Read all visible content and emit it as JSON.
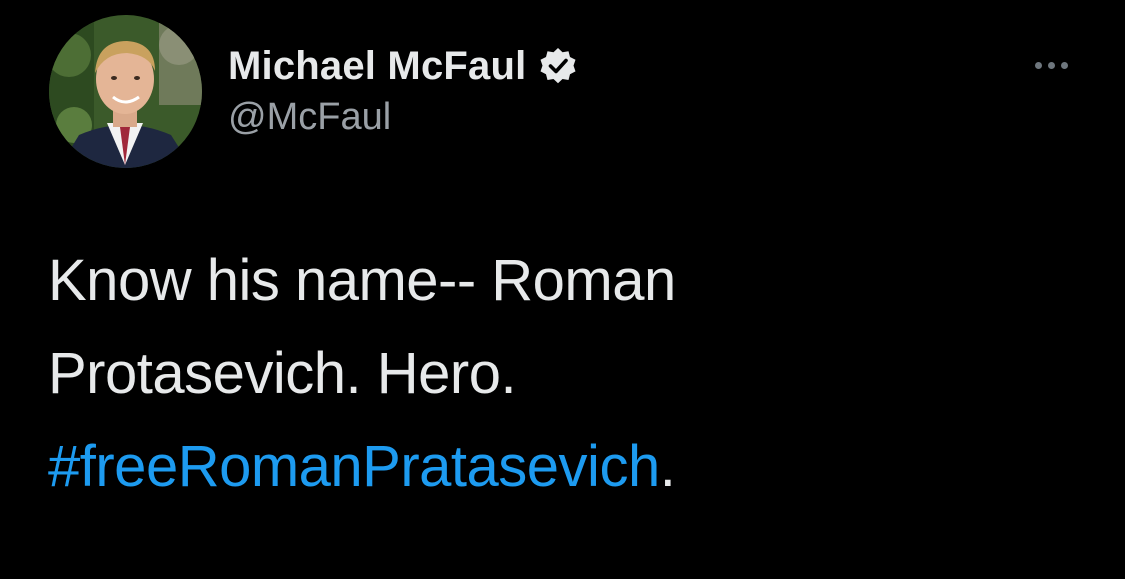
{
  "author": {
    "display_name": "Michael McFaul",
    "handle": "@McFaul",
    "verified": true
  },
  "icons": {
    "verified": "verified-badge-icon",
    "more": "more-options-icon"
  },
  "tweet": {
    "line1": "Know his name-- Roman",
    "line2": "Protasevich. Hero.",
    "hashtag": "#freeRomanPratasevich",
    "trailing": "."
  },
  "colors": {
    "background": "#000000",
    "text": "#e7e9ea",
    "secondary": "#9aa0a6",
    "hashtag": "#1d9bf0"
  }
}
